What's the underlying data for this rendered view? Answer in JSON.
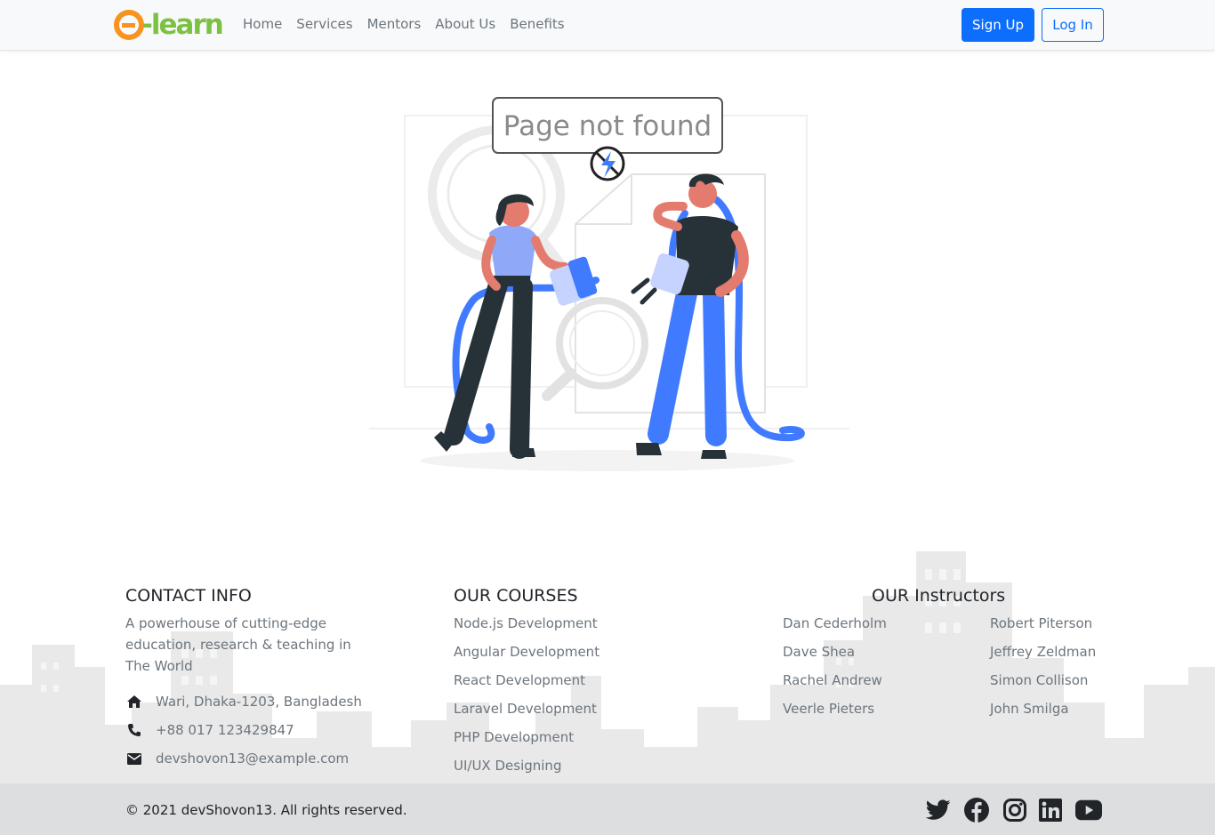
{
  "header": {
    "logo_text": "e-learn",
    "nav": [
      "Home",
      "Services",
      "Mentors",
      "About Us",
      "Benefits"
    ],
    "signup_label": "Sign Up",
    "login_label": "Log In"
  },
  "hero": {
    "message": "Page not found"
  },
  "footer": {
    "contact": {
      "title": "CONTACT INFO",
      "description": "A powerhouse of cutting-edge education, research & teaching in The World",
      "address": "Wari, Dhaka-1203, Bangladesh",
      "phone": "+88 017 123429847",
      "email": "devshovon13@example.com"
    },
    "courses": {
      "title": "OUR COURSES",
      "items": [
        "Node.js Development",
        "Angular Development",
        "React Development",
        "Laravel Development",
        "PHP Development",
        "UI/UX Designing"
      ]
    },
    "instructors": {
      "title": "OUR Instructors",
      "left": [
        "Dan Cederholm",
        "Dave Shea",
        "Rachel Andrew",
        "Veerle Pieters"
      ],
      "right": [
        "Robert Piterson",
        "Jeffrey Zeldman",
        "Simon Collison",
        "John Smilga"
      ]
    },
    "copyright": "© 2021 devShovon13. All rights reserved.",
    "social": [
      "twitter-icon",
      "facebook-icon",
      "instagram-icon",
      "linkedin-icon",
      "youtube-icon"
    ]
  },
  "colors": {
    "primary": "#0d6efd",
    "logo_orange": "#f7931e",
    "logo_green": "#7cc242",
    "illustration_blue": "#407bff"
  }
}
